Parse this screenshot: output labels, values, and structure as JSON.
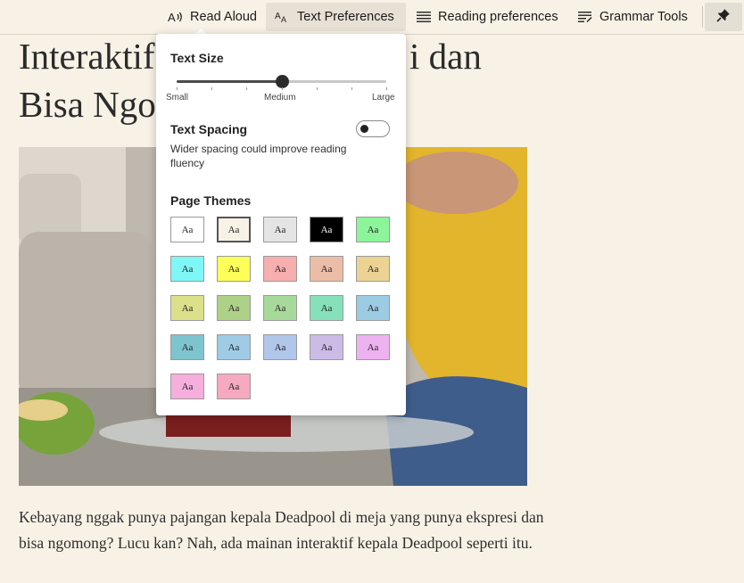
{
  "toolbar": {
    "read_aloud": "Read Aloud",
    "read_aloud_icon": "A⁾)",
    "text_prefs": "Text Preferences",
    "text_prefs_icon": "AA",
    "reading_prefs": "Reading preferences",
    "grammar": "Grammar Tools",
    "pin_icon": "pin-icon"
  },
  "article": {
    "title": "Interaktif Kepala Deadpool dengan Ekspresi dan Bisa Ngomong",
    "title_line1_left": "Interaktif",
    "title_line1_right": "i dan",
    "title_line2_left": "Bisa Ngo",
    "body": "Kebayang nggak punya pajangan kepala Deadpool di meja yang punya ekspresi dan bisa ngomong? Lucu kan? Nah, ada mainan interaktif kepala Deadpool seperti itu."
  },
  "popup": {
    "text_size": {
      "title": "Text Size",
      "min_label": "Small",
      "mid_label": "Medium",
      "max_label": "Large",
      "steps": 7,
      "value_step": 3
    },
    "text_spacing": {
      "title": "Text Spacing",
      "description": "Wider spacing could improve reading fluency",
      "enabled": false
    },
    "page_themes": {
      "title": "Page Themes",
      "label": "Aa",
      "selected_index": 1,
      "colors": [
        "#ffffff",
        "#f8f2e6",
        "#e4e4e4",
        "#000000",
        "#8cf59a",
        "#7ff7f7",
        "#fefe58",
        "#f6aeae",
        "#ebbda6",
        "#ecd393",
        "#dce189",
        "#aed188",
        "#a7d99a",
        "#86e0b9",
        "#9ccbe4",
        "#7ec4cf",
        "#9fcbe6",
        "#b0c6ea",
        "#ccbbe6",
        "#eeb2f0",
        "#f6aedc",
        "#f6a9c0"
      ]
    }
  }
}
